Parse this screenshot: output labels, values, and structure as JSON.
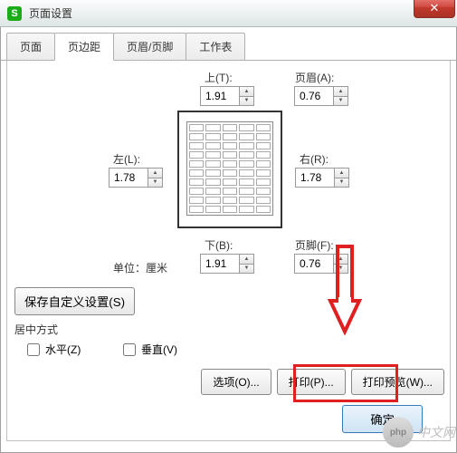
{
  "window": {
    "title": "页面设置"
  },
  "tabs": {
    "page": "页面",
    "margins": "页边距",
    "headerfooter": "页眉/页脚",
    "sheet": "工作表",
    "active_index": 1
  },
  "margins": {
    "top": {
      "label": "上(T):",
      "value": "1.91"
    },
    "bottom": {
      "label": "下(B):",
      "value": "1.91"
    },
    "left": {
      "label": "左(L):",
      "value": "1.78"
    },
    "right": {
      "label": "右(R):",
      "value": "1.78"
    },
    "header": {
      "label": "页眉(A):",
      "value": "0.76"
    },
    "footer": {
      "label": "页脚(F):",
      "value": "0.76"
    }
  },
  "unit": {
    "text": "单位：厘米"
  },
  "save_custom": {
    "label": "保存自定义设置(S)"
  },
  "center": {
    "title": "居中方式",
    "horizontal": {
      "label": "水平(Z)",
      "checked": false
    },
    "vertical": {
      "label": "垂直(V)",
      "checked": false
    }
  },
  "buttons": {
    "options": "选项(O)...",
    "print": "打印(P)...",
    "preview": "打印预览(W)...",
    "ok": "确定"
  },
  "watermark": {
    "brand": "php",
    "text": "中文网"
  }
}
